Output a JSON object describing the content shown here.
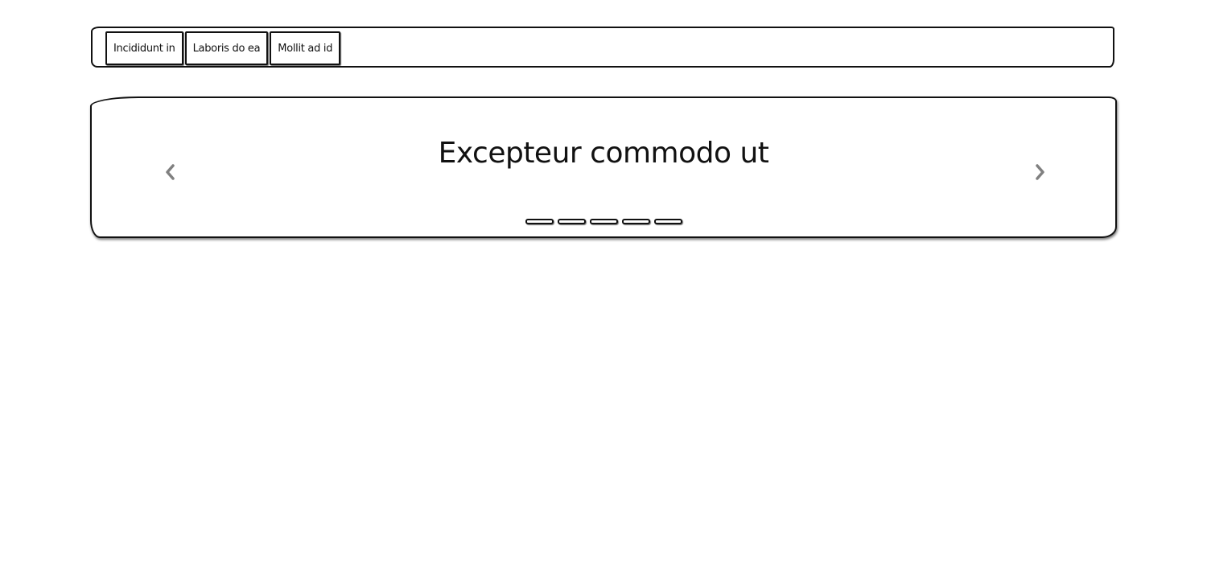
{
  "tabs": [
    {
      "label": "Incididunt in"
    },
    {
      "label": "Laboris do ea"
    },
    {
      "label": "Mollit ad id"
    }
  ],
  "carousel": {
    "title": "Excepteur commodo ut",
    "prev_icon": "chevron-left-icon",
    "next_icon": "chevron-right-icon",
    "slide_count": 5,
    "arrow_color": "#808080"
  }
}
